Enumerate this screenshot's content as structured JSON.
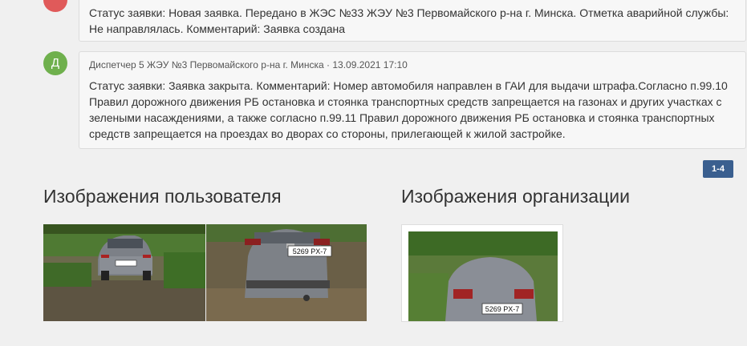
{
  "messages": [
    {
      "avatar_letter": "",
      "avatar_color": "#e05a5a",
      "text": "Статус заявки: Новая заявка. Передано в ЖЭС №33 ЖЭУ №3 Первомайского р-на г. Минска. Отметка аварийной службы: Не направлялась. Комментарий: Заявка создана"
    },
    {
      "avatar_letter": "Д",
      "avatar_color": "#6fb04d",
      "author": "Диспетчер 5 ЖЭУ №3 Первомайского р-на г. Минска",
      "separator": "·",
      "timestamp": "13.09.2021 17:10",
      "text": "Статус заявки: Заявка закрыта. Комментарий: Номер автомобиля направлен в ГАИ для выдачи штрафа.Согласно п.99.10 Правил дорожного движения РБ остановка и стоянка транспортных средств запрещается на газонах и других участках с зелеными насаждениями, а также согласно п.99.11 Правил дорожного движения РБ остановка и стоянка транспортных средств запрещается на проездах во дворах со стороны, прилегающей к жилой застройке."
    }
  ],
  "pagination": {
    "label": "1-4",
    "color": "#3a5f8f"
  },
  "sections": {
    "user_images_title": "Изображения пользователя",
    "org_images_title": "Изображения организации"
  },
  "images": {
    "user": [
      {
        "plate": "5269 PX-7"
      },
      {
        "plate": "5269 PX-7"
      }
    ],
    "org": [
      {
        "plate": "5269 PX-7"
      }
    ]
  }
}
